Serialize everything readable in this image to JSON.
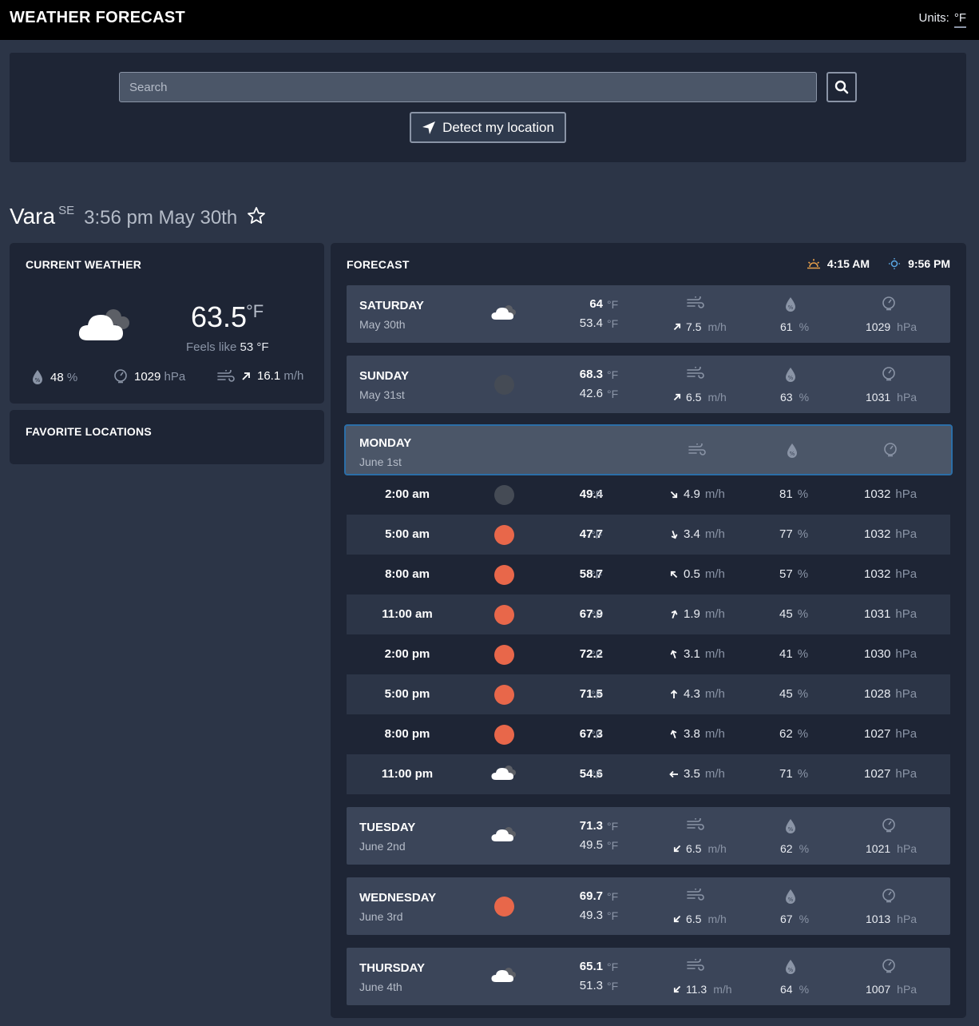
{
  "header": {
    "title": "WEATHER FORECAST",
    "units_label": "Units:",
    "units_value": "°F"
  },
  "search": {
    "placeholder": "Search",
    "detect_label": "Detect my location"
  },
  "location": {
    "city": "Vara",
    "country": "SE",
    "datetime": "3:56 pm May 30th"
  },
  "current": {
    "title": "CURRENT WEATHER",
    "icon": "cloud-icon",
    "temp": "63.5",
    "temp_unit": "°F",
    "feels_label": "Feels like",
    "feels_value": "53 °F",
    "humidity": "48",
    "humidity_unit": "%",
    "pressure": "1029",
    "pressure_unit": "hPa",
    "wind": "16.1",
    "wind_unit": "m/h"
  },
  "favorites": {
    "title": "FAVORITE LOCATIONS"
  },
  "forecast": {
    "title": "FORECAST",
    "sunrise": "4:15 AM",
    "sunset": "9:56 PM",
    "colors": {
      "sun": "#e8674a",
      "moon": "#454b55",
      "active_border": "#2b6ea8"
    },
    "days": [
      {
        "name": "SATURDAY",
        "date": "May 30th",
        "icon": "cloud-icon",
        "hi": "64",
        "lo": "53.4",
        "unit": "°F",
        "wind": "7.5",
        "wind_unit": "m/h",
        "wind_dir": "ne",
        "humidity": "61",
        "humidity_unit": "%",
        "pressure": "1029",
        "pressure_unit": "hPa"
      },
      {
        "name": "SUNDAY",
        "date": "May 31st",
        "icon": "moon-icon",
        "hi": "68.3",
        "lo": "42.6",
        "unit": "°F",
        "wind": "6.5",
        "wind_unit": "m/h",
        "wind_dir": "ne",
        "humidity": "63",
        "humidity_unit": "%",
        "pressure": "1031",
        "pressure_unit": "hPa"
      },
      {
        "name": "MONDAY",
        "date": "June 1st"
      },
      {
        "name": "TUESDAY",
        "date": "June 2nd",
        "icon": "cloud-icon",
        "hi": "71.3",
        "lo": "49.5",
        "unit": "°F",
        "wind": "6.5",
        "wind_unit": "m/h",
        "wind_dir": "sw",
        "humidity": "62",
        "humidity_unit": "%",
        "pressure": "1021",
        "pressure_unit": "hPa"
      },
      {
        "name": "WEDNESDAY",
        "date": "June 3rd",
        "icon": "sun-icon",
        "hi": "69.7",
        "lo": "49.3",
        "unit": "°F",
        "wind": "6.5",
        "wind_unit": "m/h",
        "wind_dir": "sw",
        "humidity": "67",
        "humidity_unit": "%",
        "pressure": "1013",
        "pressure_unit": "hPa"
      },
      {
        "name": "THURSDAY",
        "date": "June 4th",
        "icon": "cloud-icon",
        "hi": "65.1",
        "lo": "51.3",
        "unit": "°F",
        "wind": "11.3",
        "wind_unit": "m/h",
        "wind_dir": "sw",
        "humidity": "64",
        "humidity_unit": "%",
        "pressure": "1007",
        "pressure_unit": "hPa"
      }
    ],
    "hours": [
      {
        "time": "2:00 am",
        "icon": "moon-icon",
        "temp": "49.4",
        "unit": "°F",
        "wind": "4.9",
        "wind_unit": "m/h",
        "wind_dir": "se",
        "humidity": "81",
        "humidity_unit": "%",
        "pressure": "1032",
        "pressure_unit": "hPa"
      },
      {
        "time": "5:00 am",
        "icon": "sun-icon",
        "temp": "47.7",
        "unit": "°F",
        "wind": "3.4",
        "wind_unit": "m/h",
        "wind_dir": "sse",
        "humidity": "77",
        "humidity_unit": "%",
        "pressure": "1032",
        "pressure_unit": "hPa"
      },
      {
        "time": "8:00 am",
        "icon": "sun-icon",
        "temp": "58.7",
        "unit": "°F",
        "wind": "0.5",
        "wind_unit": "m/h",
        "wind_dir": "nw",
        "humidity": "57",
        "humidity_unit": "%",
        "pressure": "1032",
        "pressure_unit": "hPa"
      },
      {
        "time": "11:00 am",
        "icon": "sun-icon",
        "temp": "67.9",
        "unit": "°F",
        "wind": "1.9",
        "wind_unit": "m/h",
        "wind_dir": "nne",
        "humidity": "45",
        "humidity_unit": "%",
        "pressure": "1031",
        "pressure_unit": "hPa"
      },
      {
        "time": "2:00 pm",
        "icon": "sun-icon",
        "temp": "72.2",
        "unit": "°F",
        "wind": "3.1",
        "wind_unit": "m/h",
        "wind_dir": "nnw",
        "humidity": "41",
        "humidity_unit": "%",
        "pressure": "1030",
        "pressure_unit": "hPa"
      },
      {
        "time": "5:00 pm",
        "icon": "sun-icon",
        "temp": "71.5",
        "unit": "°F",
        "wind": "4.3",
        "wind_unit": "m/h",
        "wind_dir": "n",
        "humidity": "45",
        "humidity_unit": "%",
        "pressure": "1028",
        "pressure_unit": "hPa"
      },
      {
        "time": "8:00 pm",
        "icon": "sun-icon",
        "temp": "67.3",
        "unit": "°F",
        "wind": "3.8",
        "wind_unit": "m/h",
        "wind_dir": "nnw",
        "humidity": "62",
        "humidity_unit": "%",
        "pressure": "1027",
        "pressure_unit": "hPa"
      },
      {
        "time": "11:00 pm",
        "icon": "cloud-icon",
        "temp": "54.6",
        "unit": "°F",
        "wind": "3.5",
        "wind_unit": "m/h",
        "wind_dir": "w",
        "humidity": "71",
        "humidity_unit": "%",
        "pressure": "1027",
        "pressure_unit": "hPa"
      }
    ]
  }
}
